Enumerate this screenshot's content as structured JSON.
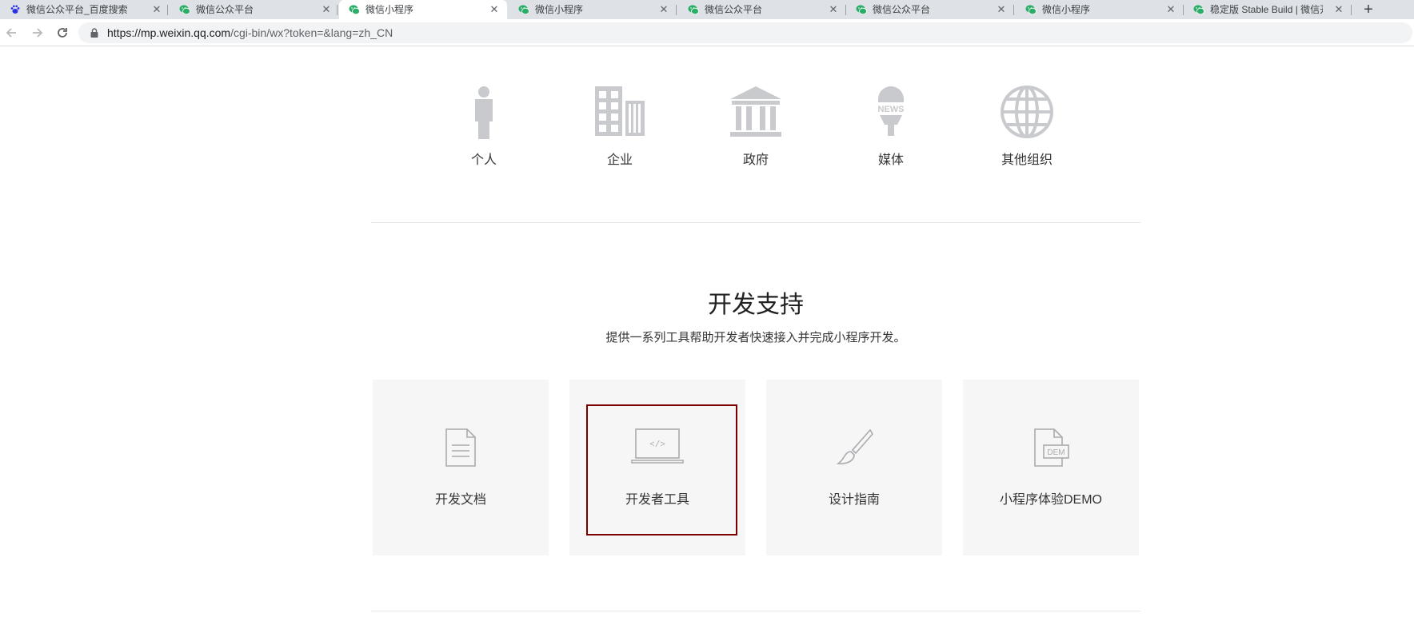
{
  "browser": {
    "tabs": [
      {
        "title": "微信公众平台_百度搜索",
        "favicon": "baidu-paw-icon",
        "active": false
      },
      {
        "title": "微信公众平台",
        "favicon": "wechat-icon",
        "active": false
      },
      {
        "title": "微信小程序",
        "favicon": "wechat-icon",
        "active": true
      },
      {
        "title": "微信小程序",
        "favicon": "wechat-icon",
        "active": false
      },
      {
        "title": "微信公众平台",
        "favicon": "wechat-icon",
        "active": false
      },
      {
        "title": "微信公众平台",
        "favicon": "wechat-icon",
        "active": false
      },
      {
        "title": "微信小程序",
        "favicon": "wechat-icon",
        "active": false
      },
      {
        "title": "稳定版 Stable Build | 微信开放文档",
        "favicon": "wechat-icon",
        "active": false
      }
    ],
    "close_glyph": "✕",
    "new_tab_glyph": "+",
    "url": {
      "host": "https://mp.weixin.qq.com",
      "path": "/cgi-bin/wx?token=&lang=zh_CN"
    }
  },
  "account_types": [
    {
      "label": "个人",
      "icon": "person-icon"
    },
    {
      "label": "企业",
      "icon": "enterprise-building-icon"
    },
    {
      "label": "政府",
      "icon": "government-building-icon"
    },
    {
      "label": "媒体",
      "icon": "news-microphone-icon"
    },
    {
      "label": "其他组织",
      "icon": "globe-icon"
    }
  ],
  "dev_support": {
    "title": "开发支持",
    "description": "提供一系列工具帮助开发者快速接入并完成小程序开发。",
    "cards": [
      {
        "label": "开发文档",
        "icon": "document-icon"
      },
      {
        "label": "开发者工具",
        "icon": "laptop-code-icon",
        "highlighted": true
      },
      {
        "label": "设计指南",
        "icon": "paintbrush-icon"
      },
      {
        "label": "小程序体验DEMO",
        "icon": "demo-file-icon"
      }
    ],
    "demo_icon_text": "DEM",
    "code_icon_text": "</>",
    "news_icon_text": "NEWS"
  },
  "colors": {
    "wechat_green": "#2aae67",
    "icon_gray": "#c8cacd",
    "highlight_border": "#7a0000"
  }
}
